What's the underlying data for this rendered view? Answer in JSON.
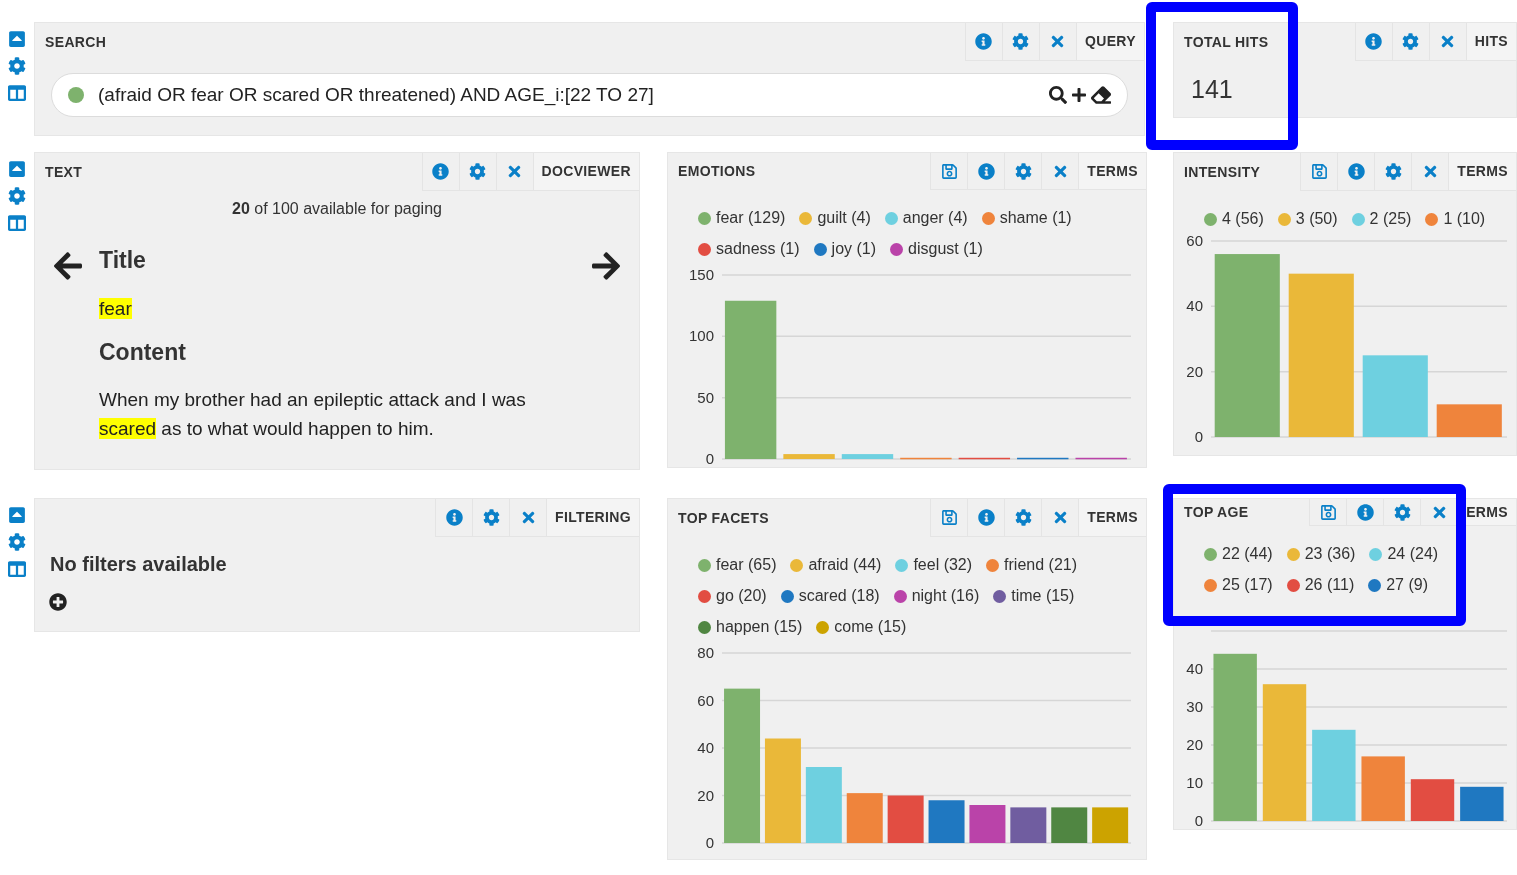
{
  "search_panel": {
    "title": "SEARCH",
    "tools": [
      {
        "kind": "info"
      },
      {
        "kind": "settings"
      },
      {
        "kind": "close"
      }
    ],
    "type_label": "QUERY",
    "query": "(afraid OR fear OR scared OR threatened) AND AGE_i:[22 TO 27]"
  },
  "hits_panel": {
    "title": "TOTAL HITS",
    "value": "141",
    "tools": [
      {
        "kind": "info"
      },
      {
        "kind": "settings"
      },
      {
        "kind": "close"
      }
    ],
    "type_label": "HITS"
  },
  "text_panel": {
    "title": "TEXT",
    "tools": [
      {
        "kind": "info"
      },
      {
        "kind": "settings"
      },
      {
        "kind": "close"
      }
    ],
    "type_label": "DOCVIEWER",
    "paging": "**20** of 100 available for paging",
    "fields": [
      {
        "heading": "Title",
        "segments": [
          {
            "text": "fear",
            "highlight": true
          }
        ]
      },
      {
        "heading": "Content",
        "segments": [
          {
            "text": "When my brother had an epileptic attack and I was ",
            "highlight": false
          },
          {
            "text": "scared",
            "highlight": true
          },
          {
            "text": " as to what would happen to him.",
            "highlight": false
          }
        ]
      }
    ]
  },
  "filter_panel": {
    "tools": [
      {
        "kind": "info"
      },
      {
        "kind": "settings"
      },
      {
        "kind": "close"
      }
    ],
    "type_label": "FILTERING",
    "message": "No filters available"
  },
  "chart_panels": [
    {
      "title": "EMOTIONS",
      "tools": [
        {
          "kind": "save"
        },
        {
          "kind": "info"
        },
        {
          "kind": "settings"
        },
        {
          "kind": "close"
        }
      ],
      "type_label": "TERMS",
      "legend": [
        {
          "label": "fear (129)",
          "color": "#7eb26d"
        },
        {
          "label": "guilt (4)",
          "color": "#eab839"
        },
        {
          "label": "anger (4)",
          "color": "#6ed0e0"
        },
        {
          "label": "shame (1)",
          "color": "#ef843c"
        },
        {
          "label": "sadness (1)",
          "color": "#e24d42"
        },
        {
          "label": "joy (1)",
          "color": "#1f78c1"
        },
        {
          "label": "disgust (1)",
          "color": "#ba43a9"
        }
      ],
      "chart_data": {
        "type": "bar",
        "values": [
          129,
          4,
          4,
          1,
          1,
          1,
          1
        ],
        "ylim": [
          0,
          150
        ],
        "yticks": [
          0,
          50,
          100,
          150
        ],
        "grid": true
      }
    },
    {
      "title": "INTENSITY",
      "tools": [
        {
          "kind": "save"
        },
        {
          "kind": "info"
        },
        {
          "kind": "settings"
        },
        {
          "kind": "close"
        }
      ],
      "type_label": "TERMS",
      "legend": [
        {
          "label": "4 (56)",
          "color": "#7eb26d"
        },
        {
          "label": "3 (50)",
          "color": "#eab839"
        },
        {
          "label": "2 (25)",
          "color": "#6ed0e0"
        },
        {
          "label": "1 (10)",
          "color": "#ef843c"
        }
      ],
      "chart_data": {
        "type": "bar",
        "values": [
          56,
          50,
          25,
          10
        ],
        "ylim": [
          0,
          60
        ],
        "yticks": [
          0,
          20,
          40,
          60
        ],
        "grid": true
      }
    },
    {
      "title": "TOP FACETS",
      "tools": [
        {
          "kind": "save"
        },
        {
          "kind": "info"
        },
        {
          "kind": "settings"
        },
        {
          "kind": "close"
        }
      ],
      "type_label": "TERMS",
      "legend": [
        {
          "label": "fear (65)",
          "color": "#7eb26d"
        },
        {
          "label": "afraid (44)",
          "color": "#eab839"
        },
        {
          "label": "feel (32)",
          "color": "#6ed0e0"
        },
        {
          "label": "friend (21)",
          "color": "#ef843c"
        },
        {
          "label": "go (20)",
          "color": "#e24d42"
        },
        {
          "label": "scared (18)",
          "color": "#1f78c1"
        },
        {
          "label": "night (16)",
          "color": "#ba43a9"
        },
        {
          "label": "time (15)",
          "color": "#705da0"
        },
        {
          "label": "happen (15)",
          "color": "#508642"
        },
        {
          "label": "come (15)",
          "color": "#cca300"
        }
      ],
      "chart_data": {
        "type": "bar",
        "values": [
          65,
          44,
          32,
          21,
          20,
          18,
          16,
          15,
          15,
          15
        ],
        "ylim": [
          0,
          80
        ],
        "yticks": [
          0,
          20,
          40,
          60,
          80
        ],
        "grid": true
      }
    },
    {
      "title": "TOP AGE",
      "tools": [
        {
          "kind": "save"
        },
        {
          "kind": "info"
        },
        {
          "kind": "settings"
        },
        {
          "kind": "close"
        }
      ],
      "type_label": "ERMS",
      "legend": [
        {
          "label": "22 (44)",
          "color": "#7eb26d"
        },
        {
          "label": "23 (36)",
          "color": "#eab839"
        },
        {
          "label": "24 (24)",
          "color": "#6ed0e0"
        },
        {
          "label": "25 (17)",
          "color": "#ef843c"
        },
        {
          "label": "26 (11)",
          "color": "#e24d42"
        },
        {
          "label": "27 (9)",
          "color": "#1f78c1"
        }
      ],
      "chart_data": {
        "type": "bar",
        "values": [
          44,
          36,
          24,
          17,
          11,
          9
        ],
        "ylim": [
          0,
          50
        ],
        "yticks": [
          0,
          10,
          20,
          30,
          40
        ],
        "grid": true
      }
    }
  ]
}
